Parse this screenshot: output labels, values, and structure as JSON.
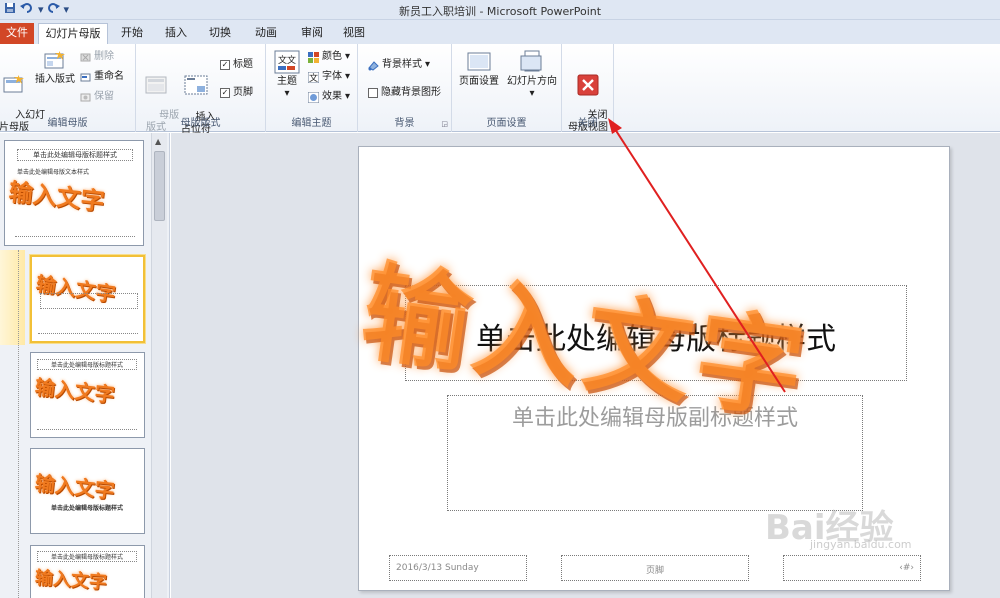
{
  "window": {
    "title": "新员工入职培训 - Microsoft PowerPoint"
  },
  "qat": {
    "save": "save-icon",
    "undo": "undo-icon",
    "redo": "redo-icon"
  },
  "tabs": [
    "文件",
    "幻灯片母版",
    "开始",
    "插入",
    "切换",
    "动画",
    "审阅",
    "视图"
  ],
  "ribbon": {
    "edit_master": {
      "label": "编辑母版",
      "insert_slide_master": "入幻灯\n片母版",
      "insert_layout": "插入版式",
      "delete": "删除",
      "rename": "重命名",
      "preserve": "保留"
    },
    "master_layout": {
      "label": "母版版式",
      "master_layout_btn": "母版\n版式",
      "insert_placeholder": "插入\n占位符",
      "title_chk": "标题",
      "footer_chk": "页脚"
    },
    "edit_theme": {
      "label": "编辑主题",
      "theme": "主题",
      "colors": "颜色",
      "fonts": "字体",
      "effects": "效果"
    },
    "background": {
      "label": "背景",
      "bg_styles": "背景样式",
      "hide_bg": "隐藏背景图形"
    },
    "page_setup": {
      "label": "页面设置",
      "page_setup_btn": "页面设置",
      "orientation": "幻灯片方向"
    },
    "close": {
      "label": "关闭",
      "close_master": "关闭\n母版视图"
    }
  },
  "thumbnails": {
    "t1_title": "单击此处编辑母版标题样式",
    "t1_body": "单击此处编辑母版文本样式",
    "t3_title": "单击此处编辑母版标题样式",
    "t4_title": "单击此处编辑母版标题样式",
    "t5_title": "单击此处编辑母版标题样式",
    "wordart": "输入文字"
  },
  "slide": {
    "title": "单击此处编辑母版标题样式",
    "subtitle": "单击此处编辑母版副标题样式",
    "date": "2016/3/13 Sunday",
    "footer": "页脚",
    "wordart": "输入文字"
  },
  "watermark": {
    "brand": "Bai经验",
    "url": "jingyan.baidu.com"
  },
  "colors": {
    "file_tab": "#d24726",
    "arrow": "#e02020",
    "wordart": "#f07a1f"
  }
}
